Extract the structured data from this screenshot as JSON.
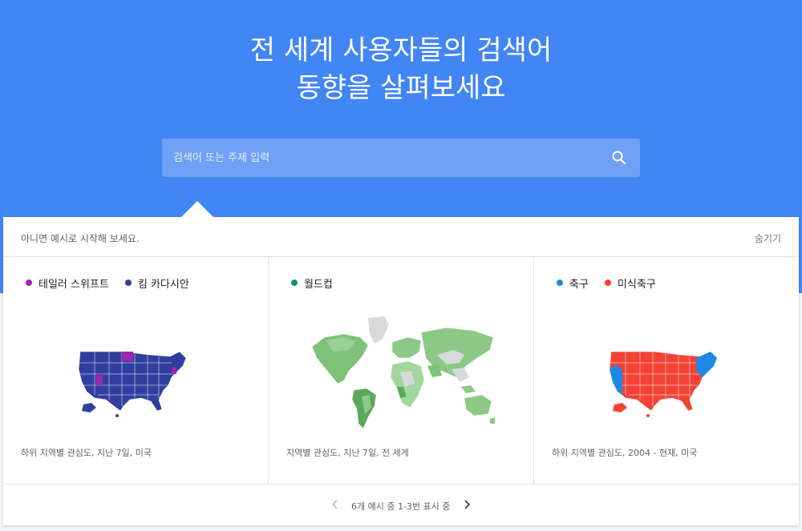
{
  "hero": {
    "title_line1": "전 세계 사용자들의 검색어",
    "title_line2": "동향을 살펴보세요"
  },
  "search": {
    "placeholder": "검색어 또는 주제 입력",
    "icon": "search-icon"
  },
  "examples": {
    "intro": "아니면 예시로 시작해 보세요.",
    "hide_label": "숨기기",
    "cards": [
      {
        "legend": [
          {
            "label": "테일러 스위프트",
            "color": "#9c27b0"
          },
          {
            "label": "킴 카다시안",
            "color": "#303f9f"
          }
        ],
        "map": "us-map",
        "caption": "하위 지역별 관심도, 지난 7일, 미국"
      },
      {
        "legend": [
          {
            "label": "월드컵",
            "color": "#0f9d58"
          }
        ],
        "map": "world-map",
        "caption": "지역별 관심도, 지난 7일, 전 세계"
      },
      {
        "legend": [
          {
            "label": "축구",
            "color": "#1e88e5"
          },
          {
            "label": "미식축구",
            "color": "#f44336"
          }
        ],
        "map": "us-map",
        "caption": "하위 지역별 관심도, 2004 - 현재, 미국"
      }
    ]
  },
  "pager": {
    "info": "6개 예시 중 1-3번 표시 중",
    "prev_icon": "chevron-left-icon",
    "next_icon": "chevron-right-icon"
  },
  "colors": {
    "hero_bg": "#4285f4",
    "search_bg": "#6ea0f6"
  }
}
